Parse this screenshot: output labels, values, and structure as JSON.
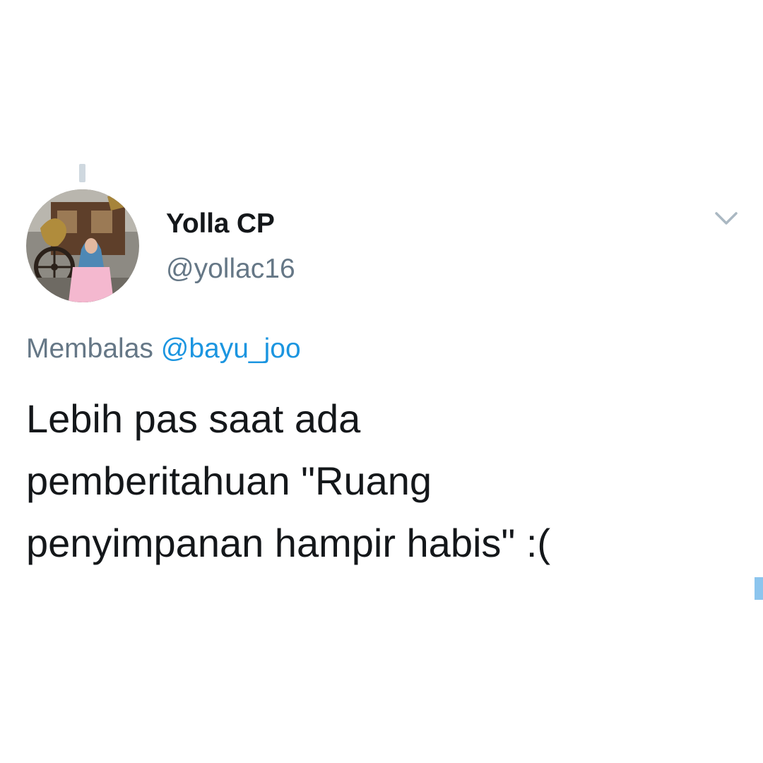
{
  "tweet": {
    "author": {
      "display_name": "Yolla CP",
      "handle": "@yollac16",
      "avatar": "profile-photo"
    },
    "menu_icon": "chevron-down-icon",
    "reply_prefix": "Membalas",
    "reply_to": "@bayu_joo",
    "text_lines": [
      "Lebih pas saat ada",
      "pemberitahuan \"Ruang",
      "penyimpanan hampir habis\" :("
    ]
  },
  "colors": {
    "text": "#14171a",
    "secondary": "#657786",
    "link": "#1b95e0",
    "thread_line": "#cfd8df",
    "accent_mark": "#8cc5ee"
  }
}
